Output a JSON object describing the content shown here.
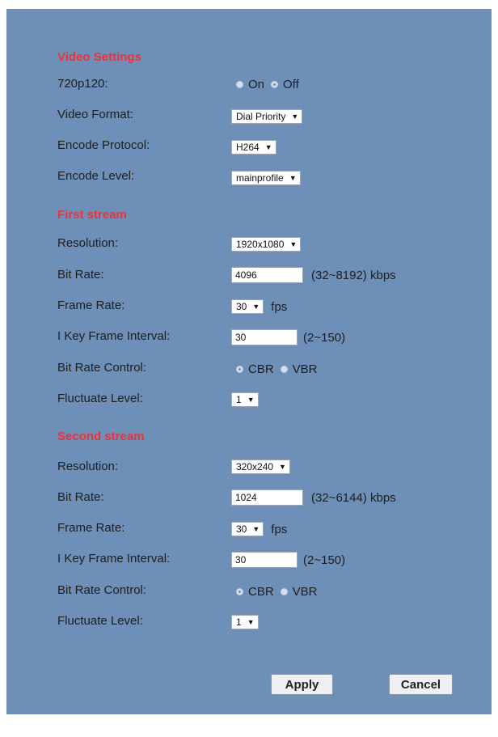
{
  "video_settings": {
    "title": "Video Settings",
    "p720_label": "720p120:",
    "p720_options": [
      "On",
      "Off"
    ],
    "p720_selected": "Off",
    "video_format_label": "Video Format:",
    "video_format_value": "Dial Priority",
    "encode_protocol_label": "Encode Protocol:",
    "encode_protocol_value": "H264",
    "encode_level_label": "Encode Level:",
    "encode_level_value": "mainprofile"
  },
  "first_stream": {
    "title": "First stream",
    "resolution_label": "Resolution:",
    "resolution_value": "1920x1080",
    "bit_rate_label": "Bit Rate:",
    "bit_rate_value": "4096",
    "bit_rate_hint": "(32~8192) kbps",
    "frame_rate_label": "Frame Rate:",
    "frame_rate_value": "30",
    "frame_rate_unit": "fps",
    "key_frame_label": "I Key Frame Interval:",
    "key_frame_value": "30",
    "key_frame_hint": "(2~150)",
    "bit_rate_control_label": "Bit Rate Control:",
    "bit_rate_control_options": [
      "CBR",
      "VBR"
    ],
    "bit_rate_control_selected": "CBR",
    "fluctuate_label": "Fluctuate Level:",
    "fluctuate_value": "1"
  },
  "second_stream": {
    "title": "Second stream",
    "resolution_label": "Resolution:",
    "resolution_value": "320x240",
    "bit_rate_label": "Bit Rate:",
    "bit_rate_value": "1024",
    "bit_rate_hint": "(32~6144) kbps",
    "frame_rate_label": "Frame Rate:",
    "frame_rate_value": "30",
    "frame_rate_unit": "fps",
    "key_frame_label": "I Key Frame Interval:",
    "key_frame_value": "30",
    "key_frame_hint": "(2~150)",
    "bit_rate_control_label": "Bit Rate Control:",
    "bit_rate_control_options": [
      "CBR",
      "VBR"
    ],
    "bit_rate_control_selected": "CBR",
    "fluctuate_label": "Fluctuate Level:",
    "fluctuate_value": "1"
  },
  "buttons": {
    "apply": "Apply",
    "cancel": "Cancel"
  },
  "colors": {
    "panel_bg": "#6d8fb8",
    "section_title": "#e8343a"
  }
}
